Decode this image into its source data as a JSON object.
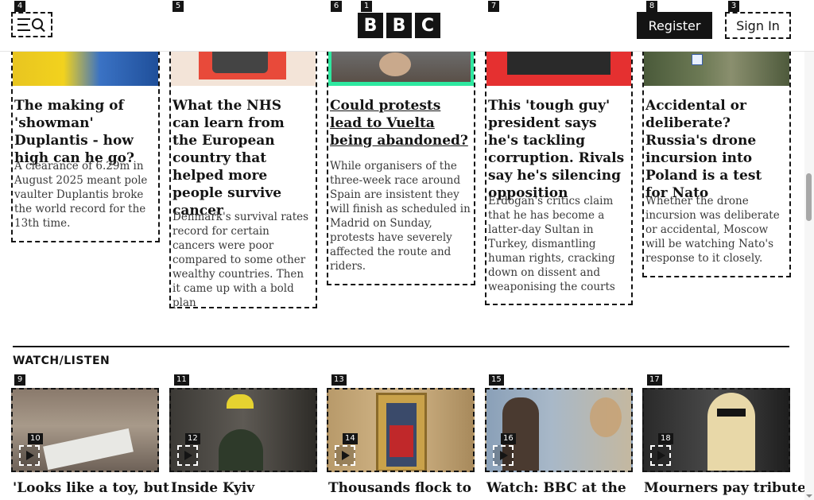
{
  "header": {
    "logo_letters": [
      "B",
      "B",
      "C"
    ],
    "register_label": "Register",
    "signin_label": "Sign In"
  },
  "badges": {
    "menu": "4",
    "card2": "5",
    "card3": "6",
    "logo": "1",
    "card4": "7",
    "register": "8",
    "signin": "3",
    "v1": "9",
    "v1_play": "10",
    "v2": "11",
    "v2_play": "12",
    "v3": "13",
    "v3_play": "14",
    "v4": "15",
    "v4_play": "16",
    "v5": "17",
    "v5_play": "18"
  },
  "stories": [
    {
      "title": "The making of 'showman' Duplantis - how high can he go?",
      "description": "A clearance of 6.29m in August 2025 meant pole vaulter Duplantis broke the world record for the 13th time."
    },
    {
      "title": "What the NHS can learn from the European country that helped more people survive cancer",
      "description": "Denmark's survival rates record for certain cancers were poor compared to some other wealthy countries. Then it came up with a bold plan"
    },
    {
      "title": "Could protests lead to Vuelta being abandoned?",
      "description": "While organisers of the three-week race around Spain are insistent they will finish as scheduled in Madrid on Sunday, protests have severely affected the route and riders."
    },
    {
      "title": "This 'tough guy' president says he's tackling corruption. Rivals say he's silencing opposition",
      "description": "Erdogan's critics claim that he has become a latter-day Sultan in Turkey, dismantling human rights, cracking down on dissent and weaponising the courts"
    },
    {
      "title": "Accidental or deliberate? Russia's drone incursion into Poland is a test for Nato",
      "description": "Whether the drone incursion was deliberate or accidental, Moscow will be watching Nato's response to it closely."
    }
  ],
  "watch": {
    "section_title": "WATCH/LISTEN",
    "videos": [
      {
        "title": "'Looks like a toy, but"
      },
      {
        "title": "Inside Kyiv"
      },
      {
        "title": "Thousands flock to"
      },
      {
        "title": "Watch: BBC at the"
      },
      {
        "title": "Mourners pay tribute"
      }
    ]
  },
  "colors": {
    "ink": "#141414",
    "brand_accent": "#2ee8a0",
    "red_bg": "#e53030"
  }
}
